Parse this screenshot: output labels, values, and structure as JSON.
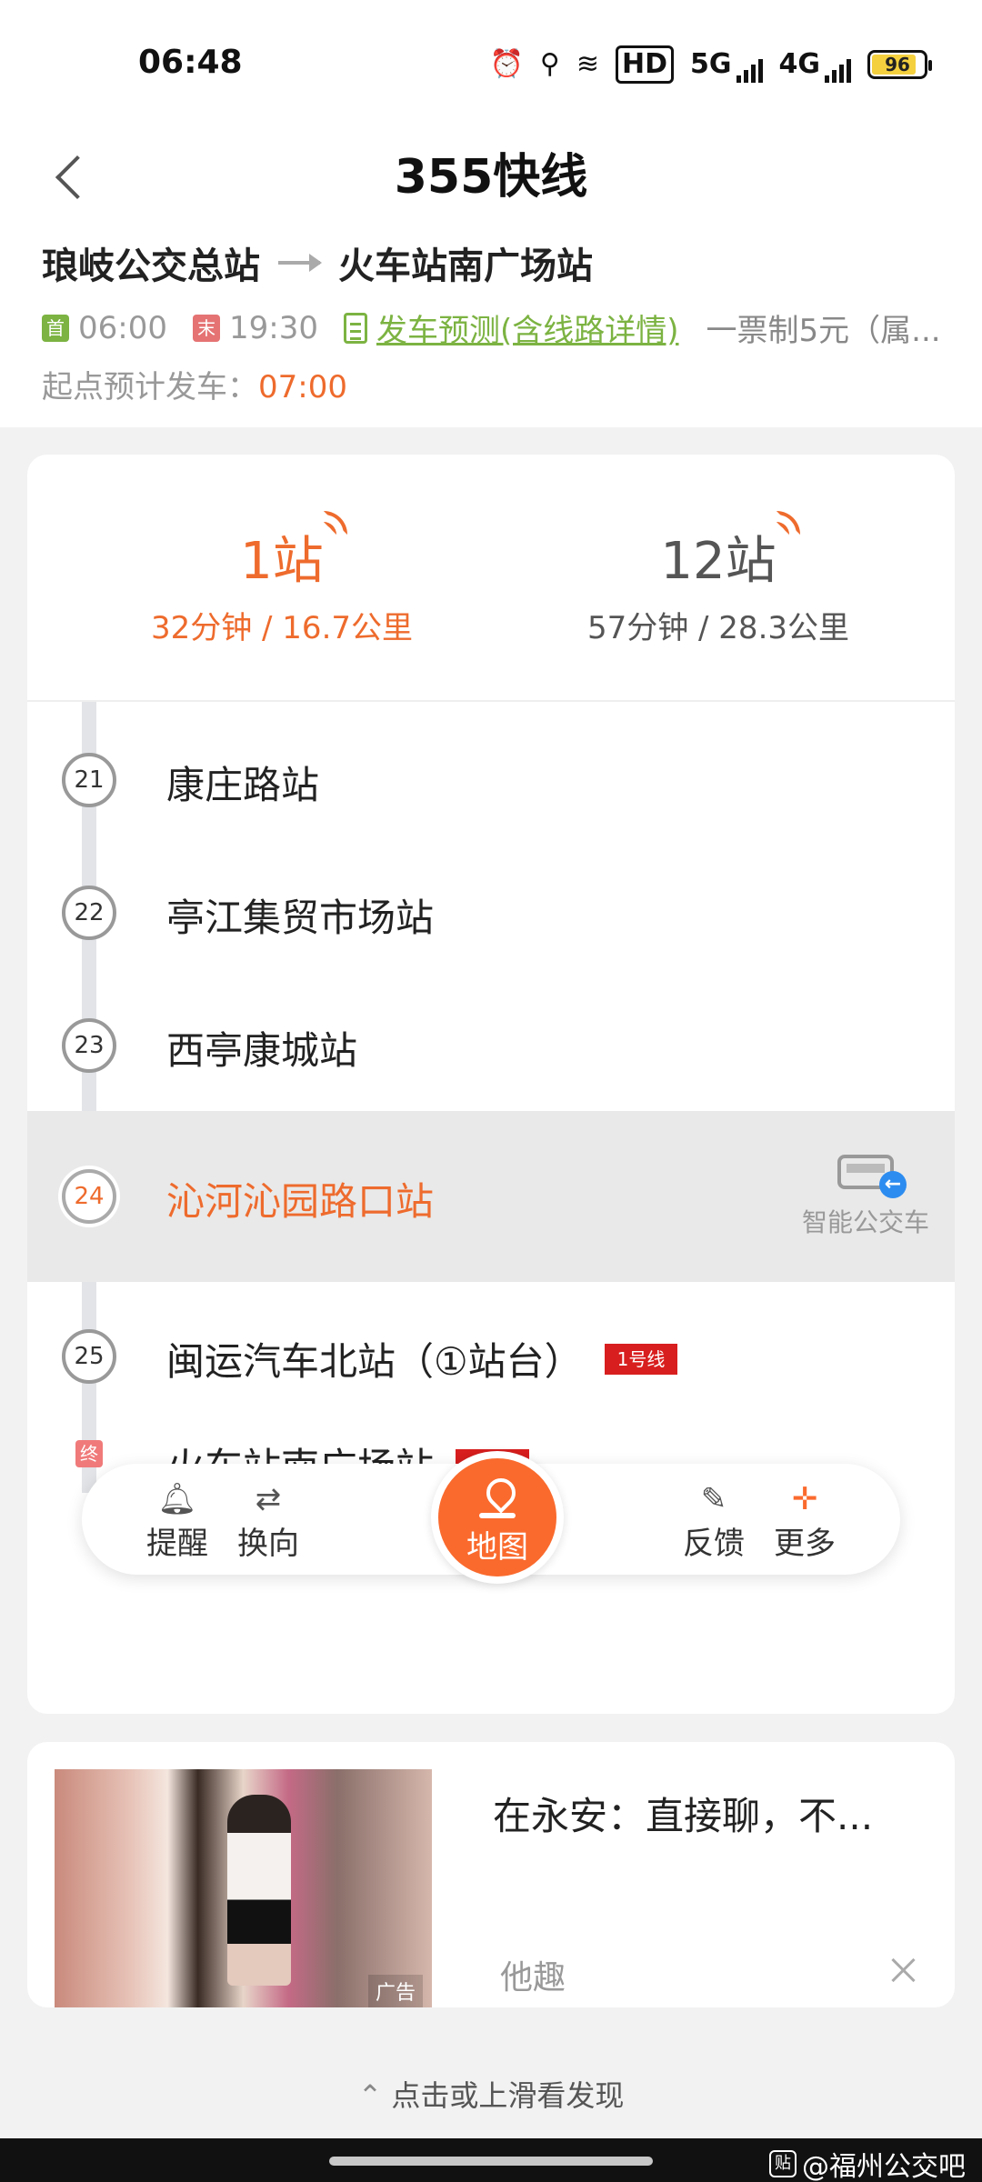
{
  "status_bar": {
    "time": "06:48",
    "network": "5G",
    "network2": "4G",
    "hd": "HD",
    "battery": "96"
  },
  "header": {
    "title": "355快线",
    "origin": "琅岐公交总站",
    "destination": "火车站南广场站",
    "first_tag": "首",
    "first_time": "06:00",
    "last_tag": "末",
    "last_time": "19:30",
    "predict_link": "发车预测(含线路详情)",
    "fare": "一票制5元（属...",
    "depart_label": "起点预计发车：",
    "depart_time": "07:00"
  },
  "eta": [
    {
      "stops": "1站",
      "meta": "32分钟 / 16.7公里"
    },
    {
      "stops": "12站",
      "meta": "57分钟 / 28.3公里"
    }
  ],
  "stops": [
    {
      "num": "21",
      "name": "康庄路站"
    },
    {
      "num": "22",
      "name": "亭江集贸市场站"
    },
    {
      "num": "23",
      "name": "西亭康城站"
    },
    {
      "num": "24",
      "name": "沁河沁园路口站",
      "badge": "智能公交车"
    },
    {
      "num": "25",
      "name": "闽运汽车北站（①站台）",
      "line": "1号线"
    },
    {
      "num": "终",
      "name": "火车站南广场站",
      "line": "1号线"
    }
  ],
  "toolbar": {
    "remind": "提醒",
    "reverse": "换向",
    "map": "地图",
    "feedback": "反馈",
    "more": "更多"
  },
  "ad": {
    "title": "在永安：直接聊，不...",
    "source": "他趣",
    "label": "广告"
  },
  "discover": "点击或上滑看发现",
  "watermark": "@福州公交吧",
  "watermark_logo": "贴",
  "colors": {
    "accent": "#ee6b2d",
    "green": "#7cb342",
    "line_tag": "#d81e1e",
    "map_button": "#fa6a2d"
  }
}
